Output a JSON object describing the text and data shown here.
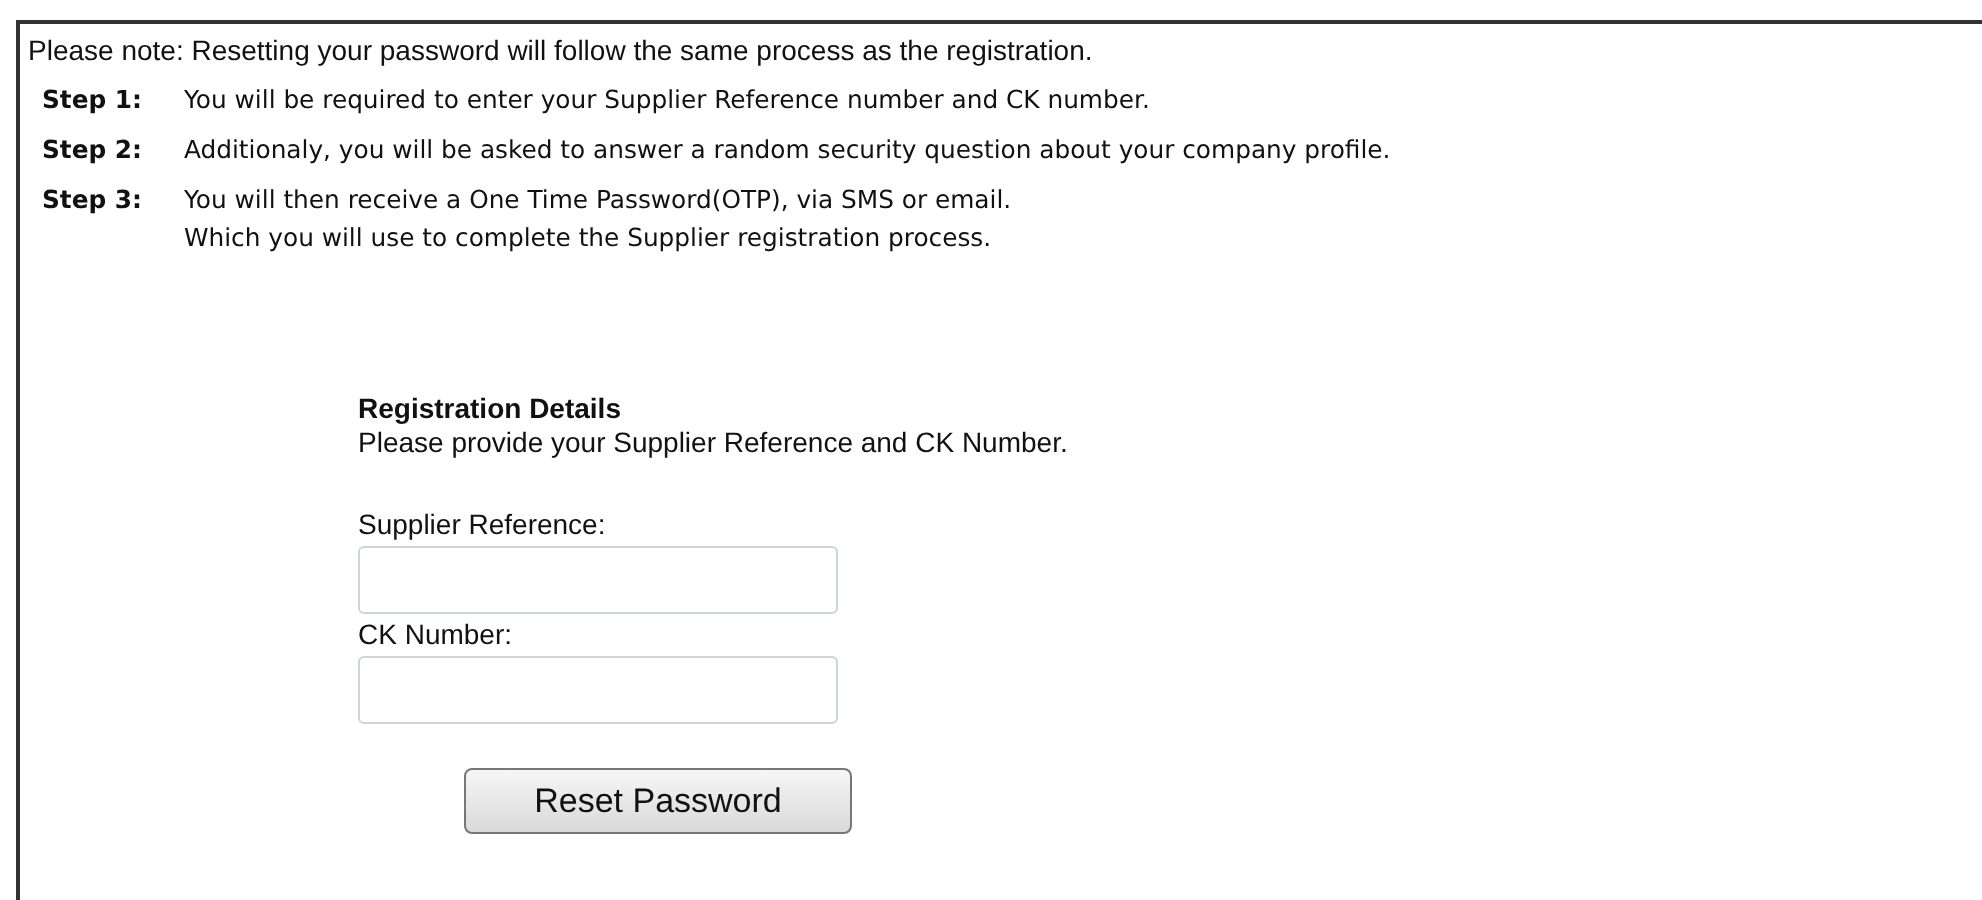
{
  "note": "Please note: Resetting your password will follow the same process as the registration.",
  "steps": [
    {
      "label": "Step 1:",
      "lines": [
        "You will be required to enter your Supplier Reference number and CK number."
      ]
    },
    {
      "label": "Step 2:",
      "lines": [
        "Additionaly, you will be asked to answer a random security question about your company profile."
      ]
    },
    {
      "label": "Step 3:",
      "lines": [
        "You will then receive a One Time Password(OTP), via SMS or email.",
        "Which you will use to complete the Supplier registration process."
      ]
    }
  ],
  "form": {
    "title": "Registration Details",
    "instruction": "Please provide your Supplier Reference and CK Number.",
    "fields": [
      {
        "label": "Supplier Reference:"
      },
      {
        "label": "CK Number:"
      }
    ],
    "button": "Reset Password"
  }
}
